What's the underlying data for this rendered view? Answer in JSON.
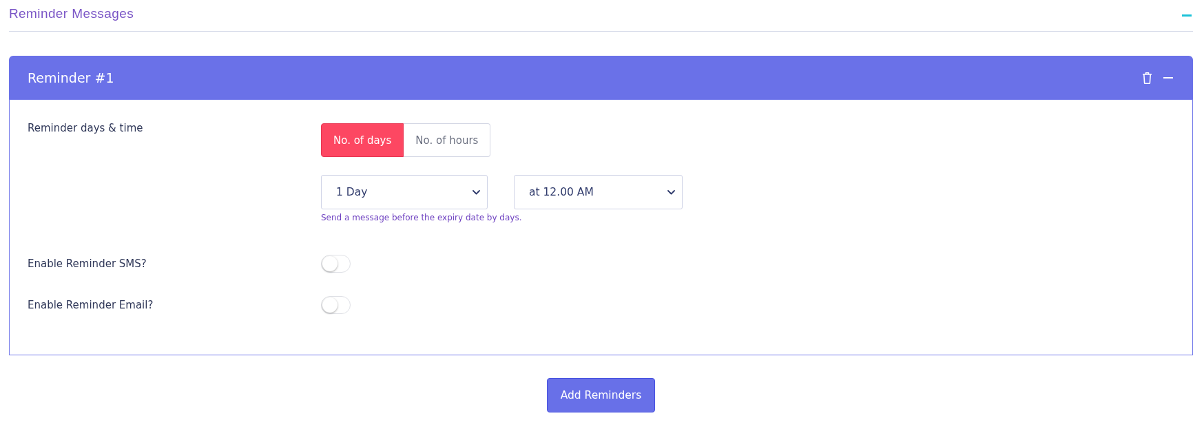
{
  "section": {
    "title": "Reminder Messages"
  },
  "reminder": {
    "title": "Reminder #1",
    "fields": [
      {
        "kind": "schedule",
        "label": "Reminder days & time",
        "modes": [
          {
            "label": "No. of days",
            "selected": true
          },
          {
            "label": "No. of hours",
            "selected": false
          }
        ],
        "selects": [
          {
            "value": "1 Day"
          },
          {
            "value": "at 12.00 AM"
          }
        ],
        "help": "Send a message before the expiry date by days."
      },
      {
        "kind": "toggle",
        "label": "Enable Reminder SMS?",
        "on": false
      },
      {
        "kind": "toggle",
        "label": "Enable Reminder Email?",
        "on": false
      }
    ]
  },
  "buttons": [
    {
      "label": "Add Reminders"
    }
  ]
}
